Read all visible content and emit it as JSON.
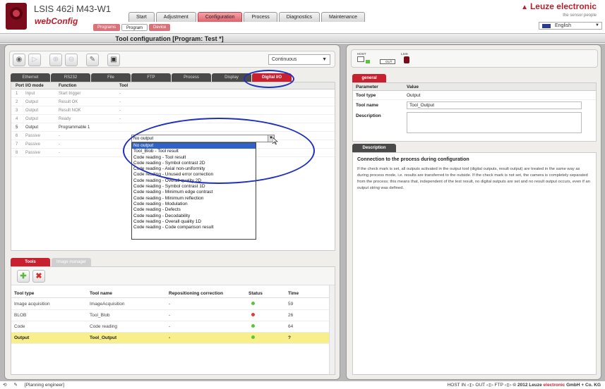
{
  "header": {
    "device_title": "LSIS 462i M43-W1",
    "app_logo": "webConfig",
    "main_tabs": [
      {
        "label": "Start"
      },
      {
        "label": "Adjustment"
      },
      {
        "label": "Configuration"
      },
      {
        "label": "Process"
      },
      {
        "label": "Diagnostics"
      },
      {
        "label": "Maintenance"
      }
    ],
    "active_main_tab": "Configuration",
    "sub_tabs": [
      {
        "label": "Programs"
      },
      {
        "label": "Program"
      },
      {
        "label": "Device"
      }
    ],
    "active_sub_tab": "Program",
    "brand": "Leuze electronic",
    "tagline": "the sensor people",
    "language": "English"
  },
  "title_bar": {
    "title": "Tool configuration   [Program: Test *]"
  },
  "toolbar": {
    "mode": "Continuous"
  },
  "config_tabs": [
    {
      "label": "Ethernet"
    },
    {
      "label": "RS232"
    },
    {
      "label": "File"
    },
    {
      "label": "FTP"
    },
    {
      "label": "Process"
    },
    {
      "label": "Display"
    },
    {
      "label": "Digital I/O"
    }
  ],
  "port_table": {
    "headers": {
      "port": "Port",
      "mode": "I/O mode",
      "function": "Function",
      "tool": "Tool"
    },
    "rows": [
      {
        "port": "1",
        "mode": "Input",
        "function": "Start trigger",
        "tool": "-"
      },
      {
        "port": "2",
        "mode": "Output",
        "function": "Result OK",
        "tool": "-"
      },
      {
        "port": "3",
        "mode": "Output",
        "function": "Result NOK",
        "tool": "-"
      },
      {
        "port": "4",
        "mode": "Output",
        "function": "Ready",
        "tool": "-"
      },
      {
        "port": "5",
        "mode": "Output",
        "function": "Programmable 1",
        "tool": ""
      },
      {
        "port": "6",
        "mode": "Passive",
        "function": "-",
        "tool": ""
      },
      {
        "port": "7",
        "mode": "Passive",
        "function": "-",
        "tool": ""
      },
      {
        "port": "8",
        "mode": "Passive",
        "function": "-",
        "tool": ""
      }
    ]
  },
  "dropdown": {
    "selected": "No output",
    "options": [
      "No output",
      "Tool_Blob - Tool result",
      "Code reading - Tool result",
      "Code reading - Symbol contrast 2D",
      "Code reading - Axial non-uniformity",
      "Code reading - Unused error correction",
      "Code reading - Overall quality 2D",
      "Code reading - Symbol contrast 1D",
      "Code reading - Minimum edge contrast",
      "Code reading - Minimum reflection",
      "Code reading - Modulation",
      "Code reading - Defects",
      "Code reading - Decodability",
      "Code reading - Overall quality 1D",
      "Code reading - Code comparison result"
    ]
  },
  "tools_tabs": [
    {
      "label": "Tools"
    },
    {
      "label": "Image manager"
    }
  ],
  "tools_table": {
    "headers": {
      "type": "Tool type",
      "name": "Tool name",
      "repo": "Repositioning correction",
      "status": "Status",
      "time": "Time"
    },
    "rows": [
      {
        "type": "Image acquisition",
        "name": "ImageAcquisition",
        "repo": "-",
        "status_color": "#5cc43a",
        "time": "59"
      },
      {
        "type": "BLOB",
        "name": "Tool_Blob",
        "repo": "-",
        "status_color": "#e03a3a",
        "time": "26"
      },
      {
        "type": "Code",
        "name": "Code reading",
        "repo": "-",
        "status_color": "#5cc43a",
        "time": "64"
      },
      {
        "type": "Output",
        "name": "Tool_Output",
        "repo": "-",
        "status_color": "#5cc43a",
        "time": "?"
      }
    ]
  },
  "diagram": {
    "host": "HOST",
    "lsis": "LSIS",
    "out": "OUT"
  },
  "general": {
    "tab": "general",
    "headers": {
      "param": "Parameter",
      "value": "Value"
    },
    "tool_type_key": "Tool type",
    "tool_type_val": "Output",
    "tool_name_key": "Tool name",
    "tool_name_val": "Tool_Output",
    "description_key": "Description",
    "description_val": ""
  },
  "description": {
    "tab": "Description",
    "title": "Connection to the process during configuration",
    "text": "If the check mark is set, all outputs activated in the output tool (digital outputs, result output) are treated in the same way as during process mode, i.e. results are transferred to the outside. If the check mark is not set, the camera is completely separated from the process; this means that, independent of the test result, no digital outputs are set and no result output occurs, even if an output string was defined."
  },
  "status_bar": {
    "user": "[Planning engineer]",
    "io": "HOST IN ◁▷ OUT ◁▷ FTP ◁▷",
    "copyright": "© 2012 Leuze",
    "copyright_red": "electronic",
    "copyright_tail": "GmbH + Co. KG"
  },
  "colors": {
    "accent": "#c8202f",
    "highlight_row": "#f8ef8c",
    "annotation": "#1f2fbe",
    "selected_option": "#2f63c8"
  }
}
